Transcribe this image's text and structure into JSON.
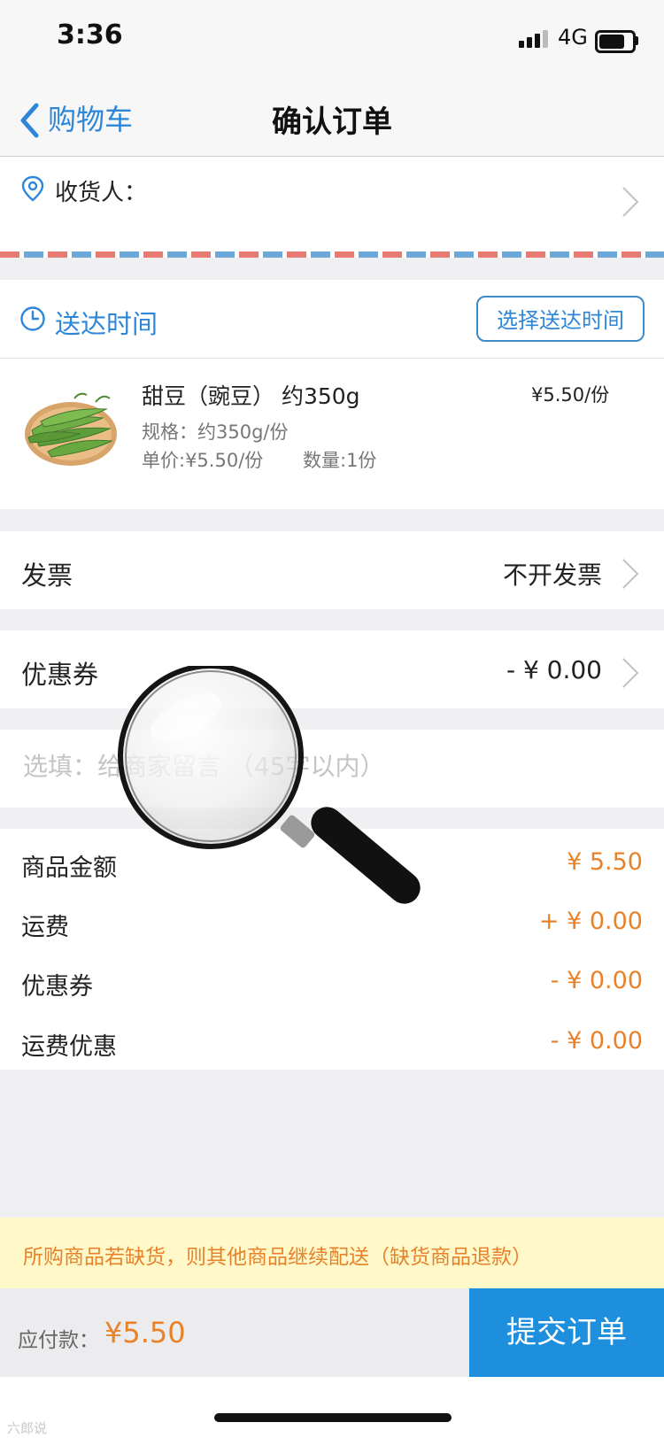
{
  "status_bar": {
    "time": "3:36",
    "network": "4G"
  },
  "nav": {
    "back_label": "购物车",
    "title": "确认订单"
  },
  "address": {
    "label": "收货人："
  },
  "delivery": {
    "label": "送达时间",
    "button_label": "选择送达时间"
  },
  "product": {
    "name": "甜豆（豌豆） 约350g",
    "spec": "规格：约350g/份",
    "unit_price": "单价:¥5.50/份",
    "quantity": "数量:1份",
    "price": "¥5.50/份"
  },
  "invoice": {
    "label": "发票",
    "value": "不开发票"
  },
  "coupon": {
    "label": "优惠券",
    "value": "- ¥ 0.00"
  },
  "message": {
    "placeholder": "选填：给商家留言 （45字以内）"
  },
  "summary": {
    "rows": [
      {
        "label": "商品金额",
        "value": "¥ 5.50"
      },
      {
        "label": "运费",
        "value": "+ ¥ 0.00"
      },
      {
        "label": "优惠券",
        "value": "- ¥ 0.00"
      },
      {
        "label": "运费优惠",
        "value": "- ¥ 0.00"
      }
    ]
  },
  "notice": {
    "text": "所购商品若缺货，则其他商品继续配送（缺货商品退款）"
  },
  "footer": {
    "payable_label": "应付款：",
    "payable_value": "¥5.50",
    "submit_label": "提交订单"
  },
  "watermark": {
    "text": "六郎说"
  },
  "colors": {
    "accent_blue": "#2e86d9",
    "price_orange": "#e8822a",
    "submit_blue": "#1e8fdc",
    "notice_bg": "#fff9c9"
  },
  "icons": [
    "back-chevron-icon",
    "location-pin-icon",
    "chevron-right-icon",
    "clock-icon",
    "magnifier-icon"
  ]
}
